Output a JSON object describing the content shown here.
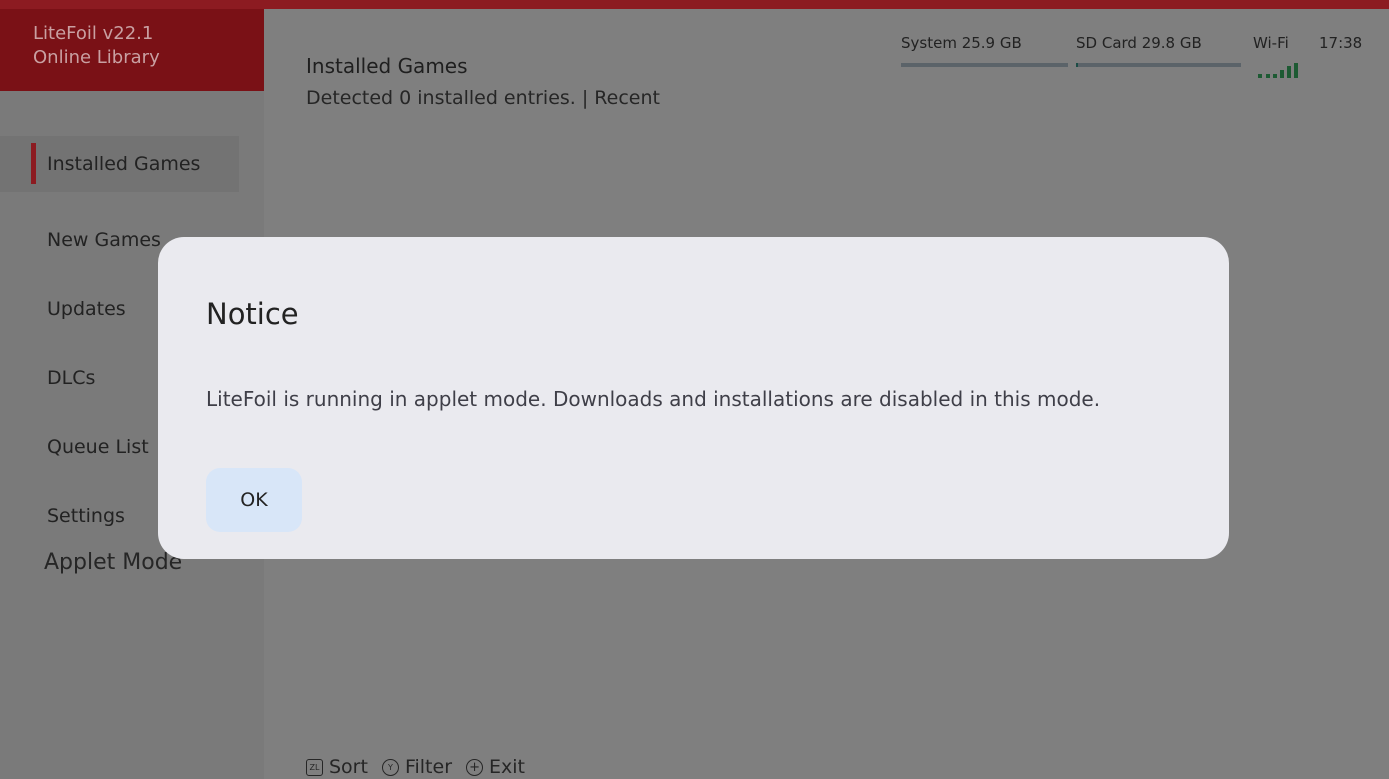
{
  "app": {
    "title_line1": "LiteFoil v22.1",
    "title_line2": "Online Library"
  },
  "sidebar": {
    "items": [
      {
        "label": "Installed Games",
        "active": true
      },
      {
        "label": "New Games"
      },
      {
        "label": "Updates"
      },
      {
        "label": "DLCs"
      },
      {
        "label": "Queue List"
      },
      {
        "label": "Settings"
      }
    ],
    "mode_label": "Applet Mode"
  },
  "header": {
    "title": "Installed Games",
    "subtitle": "Detected 0 installed entries.  |  Recent"
  },
  "status": {
    "system_label": "System 25.9 GB",
    "system_used_fraction": 0.0,
    "sd_label": "SD Card 29.8 GB",
    "sd_used_fraction": 0.01,
    "wifi_label": "Wi-Fi",
    "time": "17:38"
  },
  "footer": {
    "sort_label": "Sort",
    "sort_button": "ZL",
    "filter_label": "Filter",
    "filter_button": "Y",
    "exit_label": "Exit",
    "exit_button": "+"
  },
  "dialog": {
    "title": "Notice",
    "message": "LiteFoil is running in applet mode. Downloads and installations are disabled in this mode.",
    "ok_label": "OK"
  },
  "colors": {
    "accent_red": "#8c1b21",
    "dialog_bg": "#eaeaef",
    "ok_button_bg": "#d8e6f8"
  }
}
